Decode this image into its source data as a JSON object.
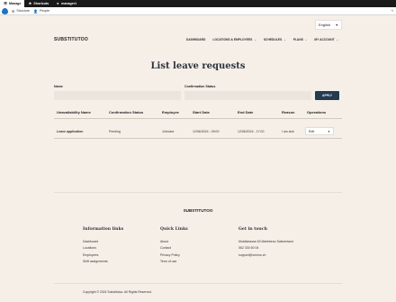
{
  "toolbar": {
    "manage": "Manage",
    "shortcuts": "Shortcuts",
    "user": "manager1"
  },
  "subbar": {
    "items": [
      "Structure",
      "People"
    ]
  },
  "language": {
    "selected": "English"
  },
  "header": {
    "brand": "SUBSTITUTOO",
    "nav": [
      "DASHBOARD",
      "LOCATIONS & EMPLOYEES",
      "SCHEDULES",
      "PLANS",
      "MY ACCOUNT"
    ]
  },
  "page": {
    "title": "List leave requests",
    "filters": {
      "name_label": "Name",
      "status_label": "Confirmation Status",
      "apply_label": "APPLY"
    }
  },
  "table": {
    "headers": [
      "Unavailability Name",
      "Confirmation Status",
      "Employee",
      "Start Date",
      "End Date",
      "Reason",
      "Operations"
    ],
    "rows": [
      {
        "name": "Leave application",
        "status": "Pending",
        "employee": "Johndoe",
        "start": "12/06/2024 - 09:00",
        "end": "12/06/2024 - 17:00",
        "reason": "I am sick",
        "operation": "Edit"
      }
    ]
  },
  "footer": {
    "brand": "SUBSTITUTOO",
    "info": {
      "title": "Information links",
      "links": [
        "Dashboard",
        "Locations",
        "Employees",
        "Shift assignments"
      ]
    },
    "quick": {
      "title": "Quick Links",
      "links": [
        "About",
        "Contact",
        "Privacy Policy",
        "Term of use"
      ]
    },
    "touch": {
      "title": "Get in touch",
      "lines": [
        "Mobilstrasse 63 Meilebeno Switzerland",
        "062 330 60 04",
        "support@omnos.ch"
      ]
    },
    "copyright": "Copyright © 2024 Substitutoo. All Rights Reserved."
  }
}
